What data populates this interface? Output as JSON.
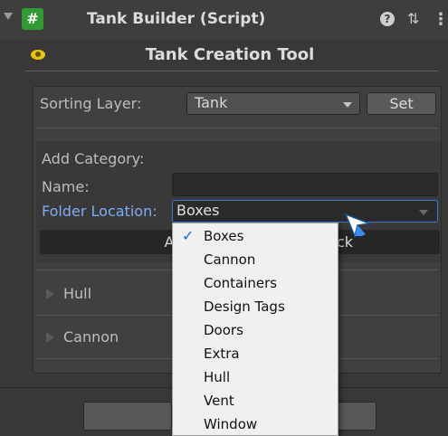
{
  "header": {
    "title": "Tank Builder (Script)",
    "script_icon_glyph": "#",
    "help_glyph": "?",
    "preset_glyph": "⇅",
    "menu_glyph": "⋮"
  },
  "tool": {
    "title": "Tank Creation Tool"
  },
  "sorting": {
    "label": "Sorting Layer:",
    "value": "Tank",
    "set_label": "Set"
  },
  "category": {
    "heading": "Add Category:",
    "name_label": "Name:",
    "name_value": "",
    "folder_label": "Folder Location:",
    "folder_value": "Boxes",
    "add_label": "Add",
    "back_label_visible": "ck"
  },
  "foldouts": [
    {
      "label": "Hull"
    },
    {
      "label": "Cannon"
    }
  ],
  "folder_options": {
    "check_glyph": "✓",
    "selected": "Boxes",
    "items": [
      {
        "label": "Boxes"
      },
      {
        "label": "Cannon"
      },
      {
        "label": "Containers"
      },
      {
        "label": "Design Tags"
      },
      {
        "label": "Doors"
      },
      {
        "label": "Extra"
      },
      {
        "label": "Hull"
      },
      {
        "label": "Vent"
      },
      {
        "label": "Window"
      }
    ]
  },
  "colors": {
    "background": "#383838",
    "script_icon": "#2f9b31",
    "eye_icon": "#e8c700",
    "focus_accent": "#3a79d6",
    "folder_label": "#7cacf8",
    "check": "#0f6bd6"
  }
}
